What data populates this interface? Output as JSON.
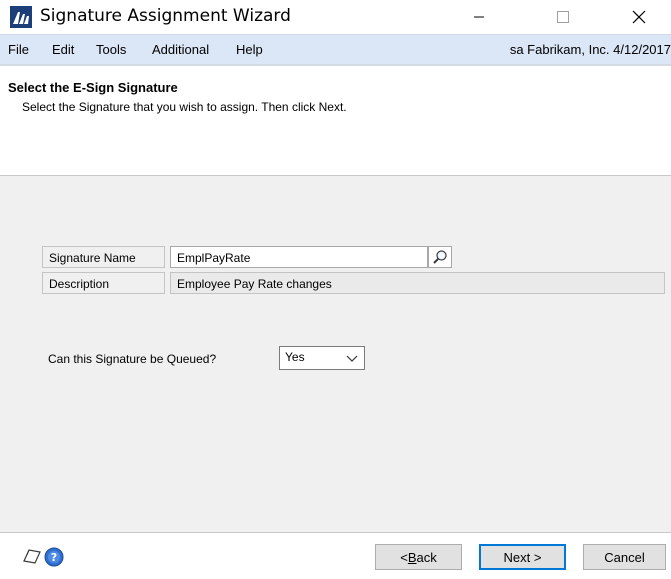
{
  "window": {
    "title": "Signature Assignment Wizard",
    "minimize_icon": "minimize-icon",
    "maximize_icon": "maximize-icon",
    "close_icon": "close-icon"
  },
  "menu": {
    "items": [
      "File",
      "Edit",
      "Tools",
      "Additional",
      "Help"
    ],
    "status": "sa  Fabrikam, Inc.  4/12/2017"
  },
  "header": {
    "title": "Select the E-Sign Signature",
    "subtitle": "Select the Signature that you wish to assign. Then click Next."
  },
  "form": {
    "signature_name_label": "Signature Name",
    "signature_name_value": "EmplPayRate",
    "description_label": "Description",
    "description_value": "Employee Pay Rate changes",
    "queue_label": "Can this Signature be Queued?",
    "queue_value": "Yes"
  },
  "buttons": {
    "back_prefix": "< ",
    "back_accel": "B",
    "back_rest": "ack",
    "next": "Next >",
    "cancel": "Cancel"
  },
  "colors": {
    "menubar": "#dbe6f7",
    "body": "#f0f0f0",
    "default_button_border": "#0078d7"
  }
}
